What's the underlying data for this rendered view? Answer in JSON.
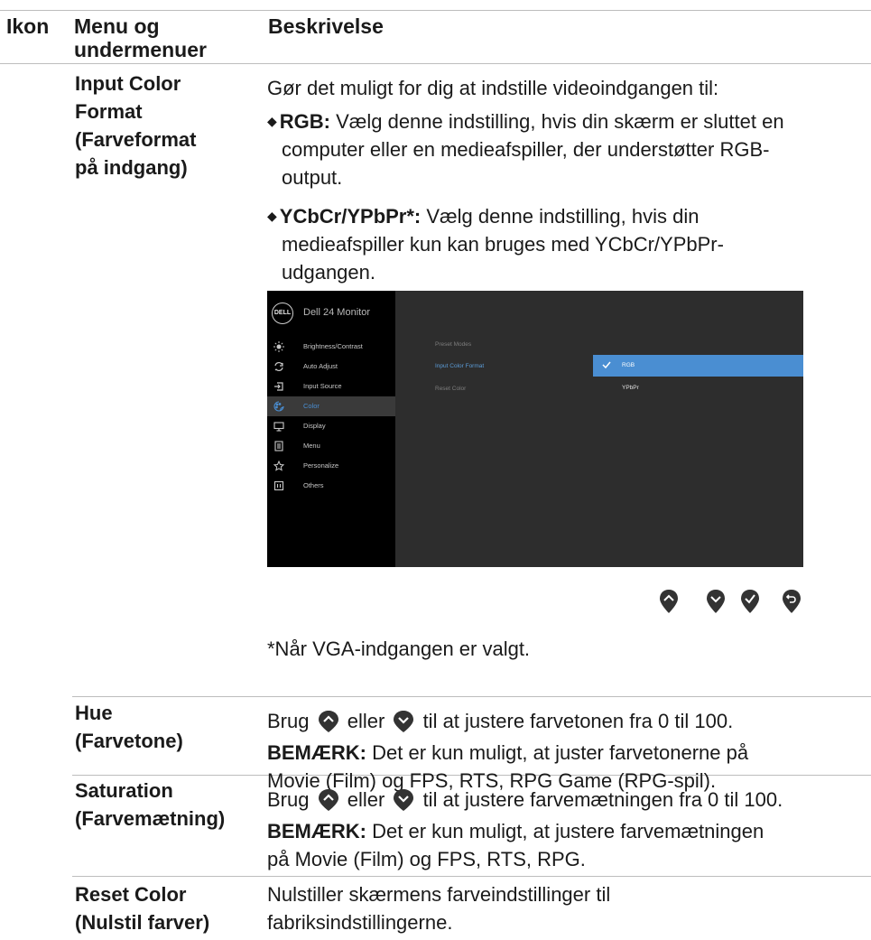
{
  "header": {
    "col_icon": "Ikon",
    "col_menu": "Menu og undermenuer",
    "col_desc": "Beskrivelse"
  },
  "input_color_format": {
    "term_line1": "Input Color",
    "term_line2": "Format",
    "term_line3": "(Farveformat",
    "term_line4": "på indgang)",
    "intro": "Gør det muligt for dig at indstille videoindgangen til:",
    "rgb_label": "RGB:",
    "rgb_line1": " Vælg denne indstilling, hvis din skærm er sluttet en",
    "rgb_line2": "computer eller en medieafspiller, der understøtter RGB-",
    "rgb_line3": "output.",
    "ycbcr_label": "YCbCr/YPbPr",
    "ycbcr_star": "*:",
    "ycbcr_line1": " Vælg denne indstilling, hvis din",
    "ycbcr_line2": "medieafspiller kun kan bruges med YCbCr/YPbPr-",
    "ycbcr_line3": "udgangen.",
    "footnote": "*Når VGA-indgangen er valgt."
  },
  "osd": {
    "logo": "DELL",
    "title": "Dell 24 Monitor",
    "menu": [
      {
        "label": "Brightness/Contrast",
        "icon": "brightness-icon"
      },
      {
        "label": "Auto Adjust",
        "icon": "auto-adjust-icon"
      },
      {
        "label": "Input Source",
        "icon": "input-source-icon"
      },
      {
        "label": "Color",
        "icon": "color-icon"
      },
      {
        "label": "Display",
        "icon": "display-icon"
      },
      {
        "label": "Menu",
        "icon": "menu-icon"
      },
      {
        "label": "Personalize",
        "icon": "star-icon"
      },
      {
        "label": "Others",
        "icon": "others-icon"
      }
    ],
    "submenu": [
      "Preset Modes",
      "Input Color Format",
      "Reset Color"
    ],
    "options": [
      "RGB",
      "YPbPr"
    ],
    "accent": "#4a8ed2"
  },
  "hue": {
    "term_line1": "Hue",
    "term_line2": "(Farvetone)",
    "use_prefix": "Brug",
    "use_mid": "eller",
    "use_suffix": "til at justere farvetonen fra 0 til 100.",
    "note_label": "BEMÆRK:",
    "note_line1": " Det er kun muligt, at juster farvetonerne på",
    "note_line2": "Movie (Film) og FPS, RTS, RPG Game (RPG-spil)."
  },
  "saturation": {
    "term_line1": "Saturation",
    "term_line2": "(Farvemætning)",
    "use_prefix": "Brug",
    "use_mid": "eller",
    "use_suffix": "til at justere farvemætningen fra 0 til 100.",
    "note_label": "BEMÆRK:",
    "note_line1": " Det er kun muligt, at justere farvemætningen",
    "note_line2": "på Movie (Film) og FPS, RTS, RPG."
  },
  "reset_color": {
    "term_line1": "Reset Color",
    "term_line2": "(Nulstil farver)",
    "desc_line1": "Nulstiller skærmens farveindstillinger til",
    "desc_line2": "fabriksindstillingerne."
  }
}
